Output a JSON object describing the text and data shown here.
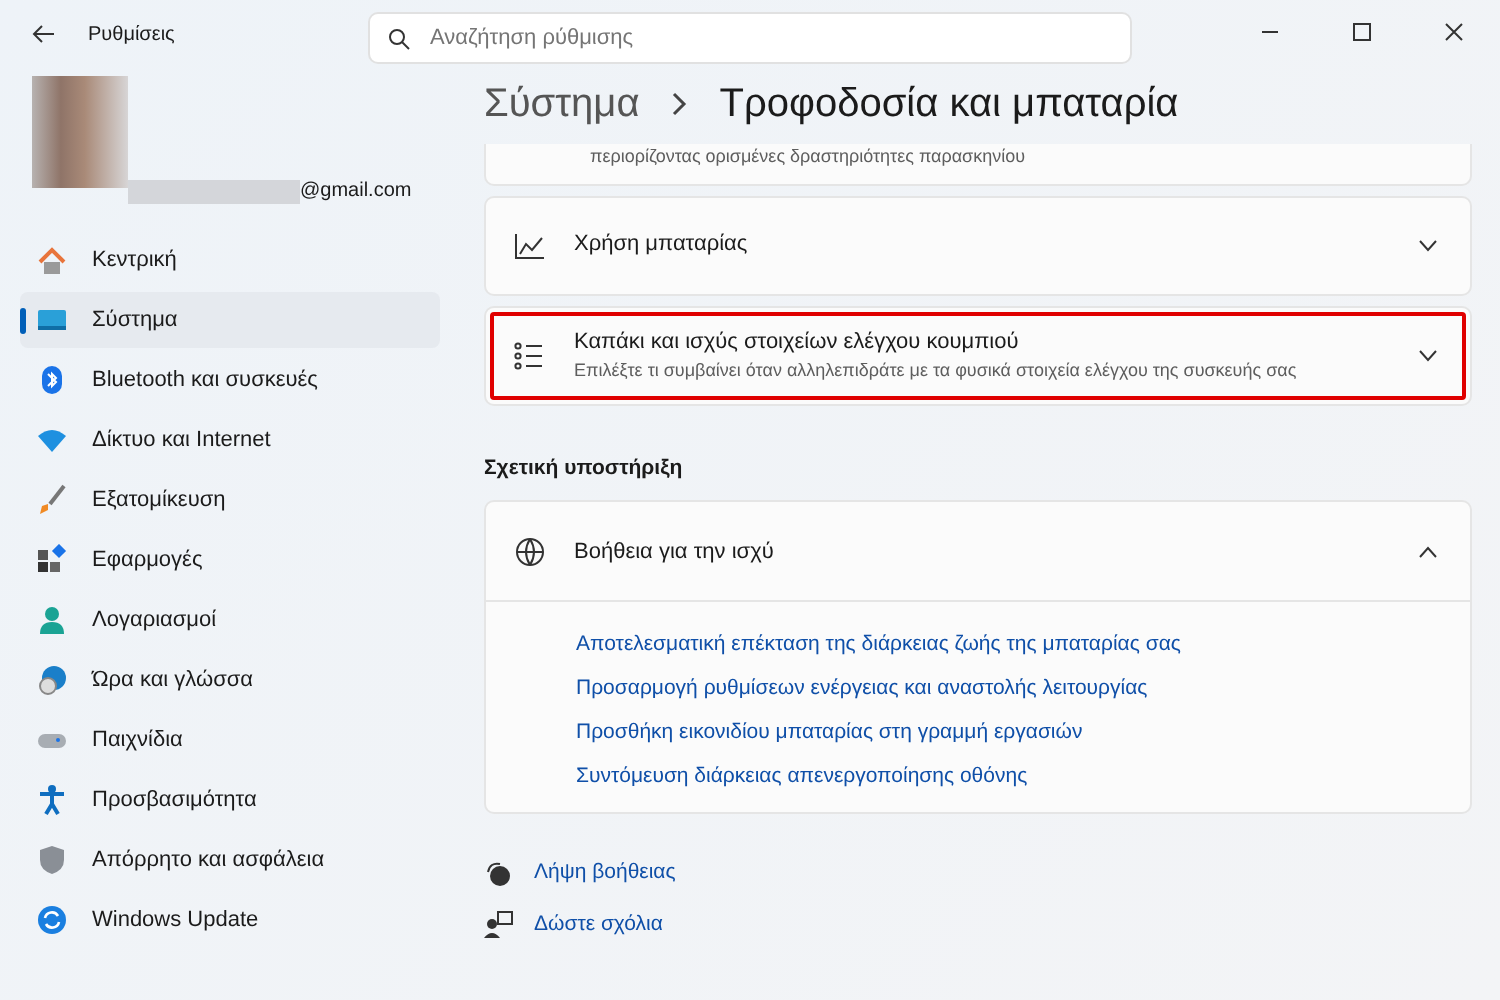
{
  "window": {
    "title": "Ρυθμίσεις"
  },
  "search": {
    "placeholder": "Αναζήτηση ρύθμισης"
  },
  "account": {
    "email": "@gmail.com"
  },
  "sidebar": {
    "items": [
      {
        "label": "Κεντρική",
        "kind": "home",
        "selected": false
      },
      {
        "label": "Σύστημα",
        "kind": "system",
        "selected": true
      },
      {
        "label": "Bluetooth και συσκευές",
        "kind": "bluetooth",
        "selected": false
      },
      {
        "label": "Δίκτυο και Internet",
        "kind": "wifi",
        "selected": false
      },
      {
        "label": "Εξατομίκευση",
        "kind": "brush",
        "selected": false
      },
      {
        "label": "Εφαρμογές",
        "kind": "apps",
        "selected": false
      },
      {
        "label": "Λογαριασμοί",
        "kind": "person",
        "selected": false
      },
      {
        "label": "Ώρα και γλώσσα",
        "kind": "clock",
        "selected": false
      },
      {
        "label": "Παιχνίδια",
        "kind": "gamepad",
        "selected": false
      },
      {
        "label": "Προσβασιμότητα",
        "kind": "access",
        "selected": false
      },
      {
        "label": "Απόρρητο και ασφάλεια",
        "kind": "shield",
        "selected": false
      },
      {
        "label": "Windows Update",
        "kind": "update",
        "selected": false
      }
    ]
  },
  "breadcrumb": [
    "Σύστημα",
    "Τροφοδοσία και μπαταρία"
  ],
  "cards": [
    {
      "kind": "partial",
      "description": "περιορίζοντας ορισμένες δραστηριότητες παρασκηνίου"
    },
    {
      "kind": "chart",
      "title": "Χρήση μπαταρίας",
      "highlighted": false
    },
    {
      "kind": "list",
      "title": "Καπάκι και ισχύς στοιχείων ελέγχου κουμπιού",
      "description": "Επιλέξτε τι συμβαίνει όταν αλληλεπιδράτε με τα φυσικά στοιχεία ελέγχου της συσκευής σας",
      "highlighted": true
    }
  ],
  "support": {
    "heading": "Σχετική υποστήριξη",
    "title": "Βοήθεια για την ισχύ",
    "expanded": true,
    "links": [
      "Αποτελεσματική επέκταση της διάρκειας ζωής της μπαταρίας σας",
      "Προσαρμογή ρυθμίσεων ενέργειας και αναστολής λειτουργίας",
      "Προσθήκη εικονιδίου μπαταρίας στη γραμμή εργασιών",
      "Συντόμευση διάρκειας απενεργοποίησης οθόνης"
    ]
  },
  "footer_links": [
    {
      "label": "Λήψη βοήθειας",
      "kind": "help"
    },
    {
      "label": "Δώστε σχόλια",
      "kind": "feedback"
    }
  ]
}
